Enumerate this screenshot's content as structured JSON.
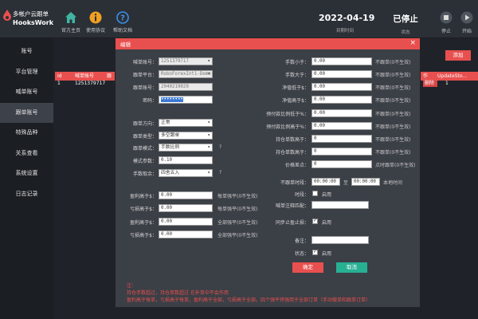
{
  "app": {
    "name_cn": "多帐户云跟单",
    "name_en": "HooksWork"
  },
  "toolbar": {
    "home": "官方主页",
    "license": "使用协议",
    "help": "帮助文档"
  },
  "expiry": {
    "value": "2022-04-19",
    "label": "到期时间"
  },
  "status": {
    "value": "已停止",
    "label": "状态"
  },
  "actions": {
    "stop": "停止",
    "start": "开始"
  },
  "sidebar": {
    "items": [
      {
        "label": "账号"
      },
      {
        "label": "平台管理"
      },
      {
        "label": "喊单账号"
      },
      {
        "label": "跟单账号"
      },
      {
        "label": "特殊品种"
      },
      {
        "label": "关系查看"
      },
      {
        "label": "系统设置"
      },
      {
        "label": "日志记录"
      }
    ]
  },
  "main": {
    "add_label": "添加",
    "left_table": {
      "headers": [
        "Id",
        "喊单账号",
        "跟"
      ],
      "row": [
        "1",
        "1251379717"
      ]
    },
    "right_table": {
      "headers": [
        "作",
        "UpdateSto..."
      ],
      "row": [
        "删除",
        "1"
      ]
    }
  },
  "modal": {
    "title": "编辑",
    "close": "×",
    "left": {
      "signal_account_label": "喊单账号：",
      "signal_account_value": "1251379717",
      "follow_platform_label": "跟单平台：",
      "follow_platform_value": "RoboForexInt1-Demo.",
      "follow_account_label": "跟单账号：",
      "follow_account_value": "2040219029",
      "password_label": "密码：",
      "password_value": "••••••••",
      "direction_label": "跟单方向：",
      "direction_value": "正常",
      "type_label": "跟单类型：",
      "type_value": "多空跟单",
      "mode_label": "跟单模式：",
      "mode_value": "手数比例",
      "mode_param_label": "模式参数：",
      "mode_param_value": "0.10",
      "lot_round_label": "手数取余：",
      "lot_round_value": "四舍五入",
      "q1": "?",
      "q2": "?",
      "profit_gt_label": "盈利高于$：",
      "profit_gt_value": "0.00",
      "profit_gt_hint": "每单强平(0不生效)",
      "loss_gt_label": "亏损高于$：",
      "loss_gt_value": "0.00",
      "loss_gt_hint": "每单强平(0不生效)",
      "profit_gt2_label": "盈利高于$：",
      "profit_gt2_value": "0.00",
      "profit_gt2_hint": "全部强平(0不生效)",
      "loss_gt2_label": "亏损高于$：",
      "loss_gt2_value": "0.00",
      "loss_gt2_hint": "全部强平(0不生效)"
    },
    "right": {
      "lot_lt_label": "手数小于：",
      "lot_lt_value": "0.00",
      "lot_lt_hint": "不跟单(0不生效)",
      "lot_gt_label": "手数大于：",
      "lot_gt_value": "0.00",
      "lot_gt_hint": "不跟单(0不生效)",
      "equity_lt_label": "净值低于$：",
      "equity_lt_value": "0.00",
      "equity_lt_hint": "不跟单(0不生效)",
      "equity_gt_label": "净值高于$：",
      "equity_gt_value": "0.00",
      "equity_gt_hint": "不跟单(0不生效)",
      "prepay_lt_label": "预付款比例低于%：",
      "prepay_lt_value": "0.00",
      "prepay_lt_hint": "不跟单(0不生效)",
      "prepay_gt_label": "预付款比例高于%：",
      "prepay_gt_value": "0.00",
      "prepay_gt_hint": "不跟单(0不生效)",
      "hold_gt_label": "持仓单数高于：",
      "hold_gt_value": "0",
      "hold_gt_hint": "不跟单(0不生效)",
      "hold_gt2_label": "持仓单数高于：",
      "hold_gt2_value": "0",
      "hold_gt2_hint": "不跟单(0不生效)",
      "price_diff_label": "价格差点：",
      "price_diff_value": "0",
      "price_diff_hint": "点时跟单(0不生效)",
      "no_follow_time_label": "不跟单时段：",
      "time_from": "00:00:00",
      "time_sep": "至",
      "time_to": "00:00:00",
      "time_hint": "本地时间",
      "period_label": "时段：",
      "period_check_label": "启用",
      "comment_label": "喊单注释匹配：",
      "comment_value": "",
      "sync_tp_label": "同步止盈止损：",
      "sync_tp_check_label": "启用",
      "remark_label": "备注：",
      "remark_value": "",
      "state_label": "状态：",
      "state_check_label": "启用",
      "ok": "确定",
      "cancel": "取消"
    },
    "notes": [
      "注：",
      "持仓手数超过，持仓单数超过 在补单中不会作用",
      "盈利高于每单，亏损高于每单，盈利高于全部，亏损高于全部。四个强平将强用于全部订单（手动做单和跟单订单）"
    ]
  },
  "colors": {
    "accent": "#e8504f",
    "teal": "#28b093",
    "sidebar_bg": "#1b1e23",
    "header_bg": "#2b3037",
    "modal_bg": "#3b3f46"
  }
}
